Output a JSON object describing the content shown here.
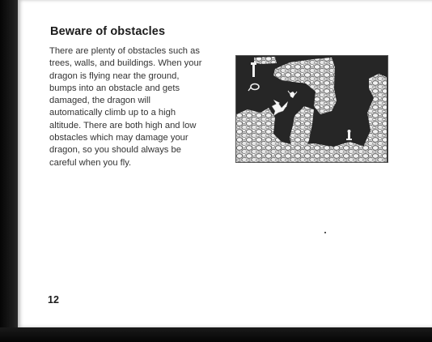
{
  "heading": "Beware of obstacles",
  "body_lines": [
    "There are plenty of obstacles such as",
    "trees, walls, and buildings. When your",
    "dragon is flying near the ground,",
    "bumps into an obstacle and gets",
    "damaged, the dragon will",
    "automatically climb up to a high",
    "altitude. There are both high and low",
    "obstacles which may damage your",
    "dragon, so you should always be",
    "careful when you fly."
  ],
  "page_number": "12",
  "colors": {
    "page_background": "#ffffff",
    "text": "#333333",
    "heading": "#1c1c1c",
    "game_background": "#262626",
    "rocks": "#d9d9d9"
  },
  "icons": [
    "dragon-sprite",
    "enemy-sprite",
    "ring-sprite",
    "pole-sprite",
    "bottle-sprite"
  ]
}
